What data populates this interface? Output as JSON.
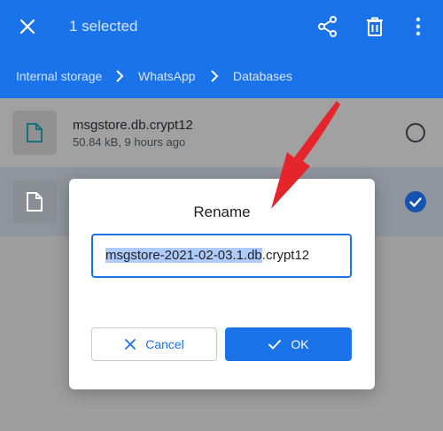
{
  "appbar": {
    "selection_title": "1 selected",
    "icons": [
      "close-icon",
      "share-icon",
      "trash-icon",
      "more-vertical-icon"
    ]
  },
  "breadcrumb": {
    "items": [
      "Internal storage",
      "WhatsApp",
      "Databases"
    ]
  },
  "files": [
    {
      "name": "msgstore.db.crypt12",
      "meta": "50.84 kB, 9 hours ago",
      "selected": false
    }
  ],
  "dialog": {
    "title": "Rename",
    "input_selected_text": "msgstore-2021-02-03.1.db",
    "input_rest_text": ".crypt12",
    "cancel_label": "Cancel",
    "ok_label": "OK"
  },
  "colors": {
    "accent": "#1a73e8",
    "annotation_arrow": "#e5242b"
  }
}
